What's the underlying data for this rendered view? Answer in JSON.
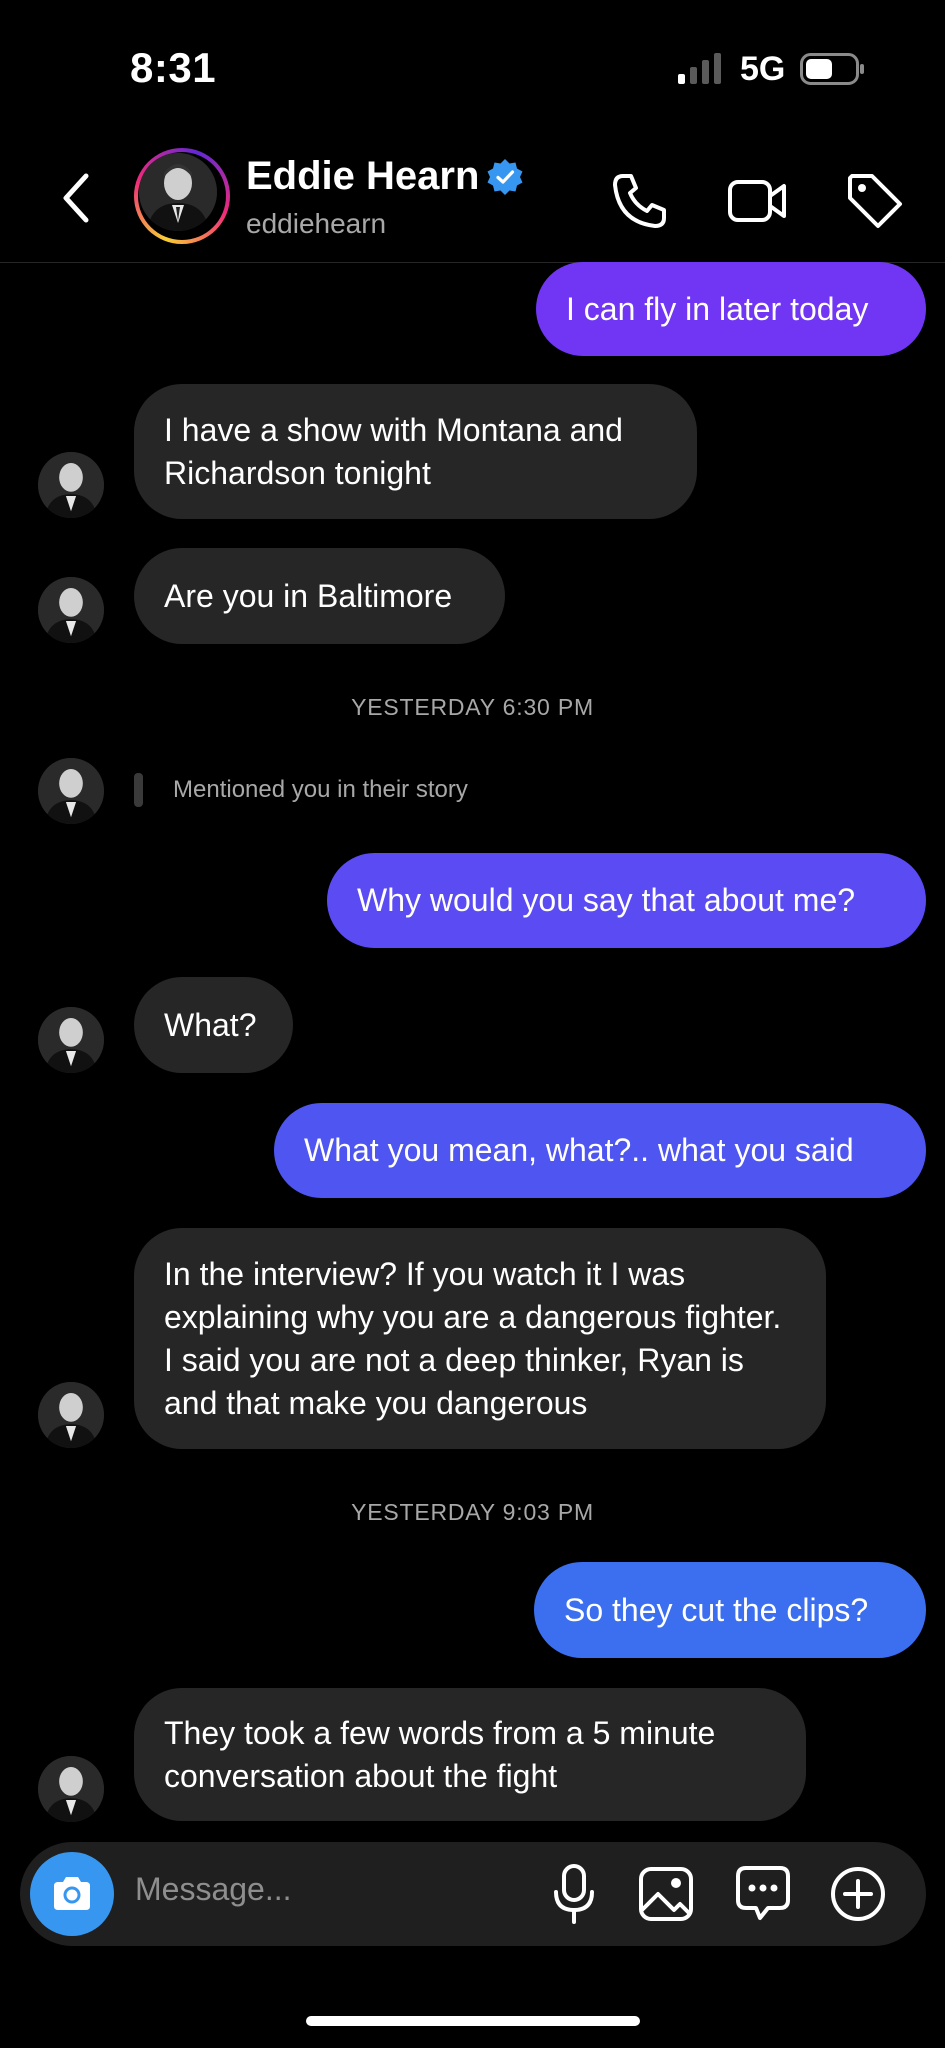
{
  "status_bar": {
    "time": "8:31",
    "network": "5G"
  },
  "header": {
    "name": "Eddie Hearn",
    "handle": "eddiehearn",
    "icons": [
      "back-icon",
      "phone-icon",
      "video-icon",
      "tag-icon",
      "verified-badge-icon"
    ]
  },
  "colors": {
    "outgoing_top": "#7136f4",
    "outgoing_mid": "#4e55f0",
    "outgoing_bottom": "#3b6ff0",
    "incoming": "#262626",
    "accent": "#3797f0"
  },
  "messages": [
    {
      "dir": "out",
      "text": "I can fly in later today"
    },
    {
      "dir": "in",
      "text": "I have a show with Montana and Richardson tonight"
    },
    {
      "dir": "in",
      "text": "Are you in Baltimore"
    },
    {
      "type": "timestamp",
      "text": "YESTERDAY 6:30 PM"
    },
    {
      "dir": "in",
      "type": "story_mention",
      "text": "Mentioned you in their story"
    },
    {
      "dir": "out",
      "text": "Why would you say that about me?"
    },
    {
      "dir": "in",
      "text": "What?"
    },
    {
      "dir": "out",
      "text": "What you mean, what?.. what you said"
    },
    {
      "dir": "in",
      "text": "In the interview? If you watch it I was explaining why you are a dangerous fighter. I said you are not a deep thinker, Ryan is and that make you dangerous"
    },
    {
      "type": "timestamp",
      "text": "YESTERDAY 9:03 PM"
    },
    {
      "dir": "out",
      "text": "So they cut the clips?"
    },
    {
      "dir": "in",
      "text": "They took a few words from a 5 minute conversation about the fight"
    }
  ],
  "composer": {
    "placeholder": "Message...",
    "icons": [
      "camera-icon",
      "microphone-icon",
      "gallery-icon",
      "sticker-icon",
      "plus-icon"
    ]
  }
}
